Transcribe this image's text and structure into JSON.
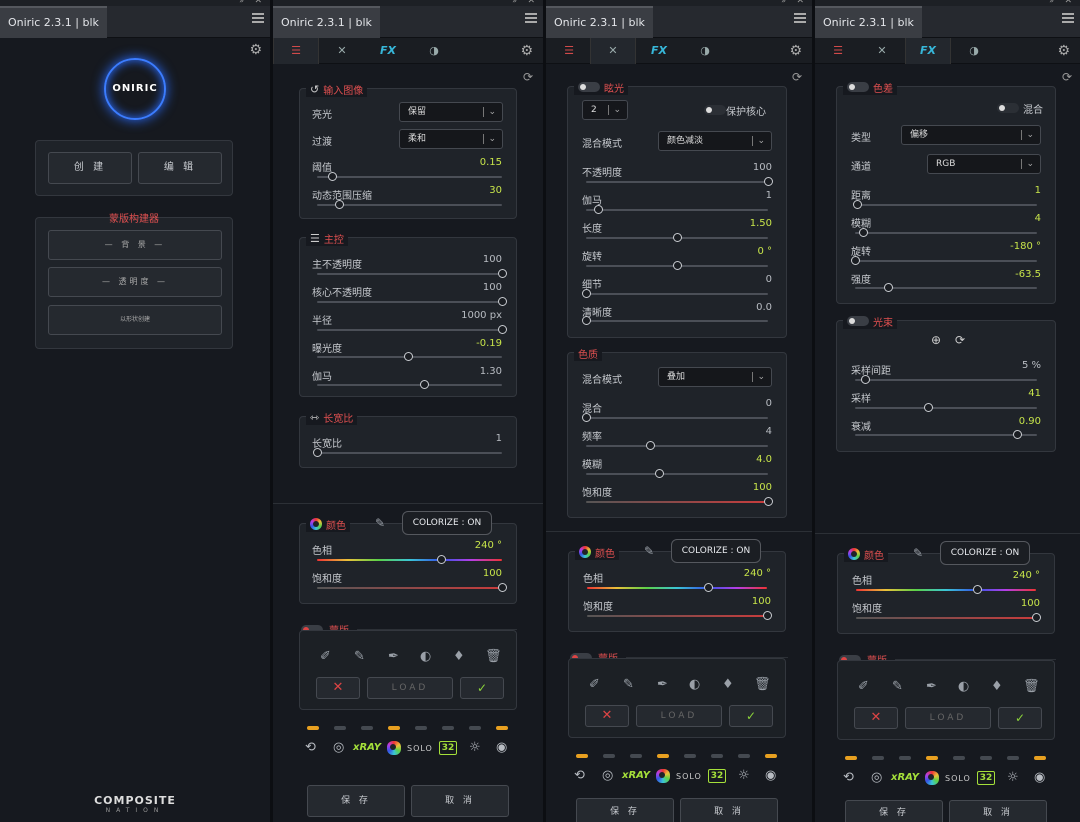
{
  "app_title": "Oniric 2.3.1 | blk",
  "brand": {
    "logo_text": "ONIRIC",
    "footer_main": "COMPOSITE",
    "footer_sub": "NATION"
  },
  "panel1": {
    "btn_create": "创 建",
    "btn_edit": "编 辑",
    "section_title": "蒙版构建器",
    "btn_layer": "— 背 景 —",
    "btn_transparency": "— 透明度 —",
    "btn_small": "以形状创建"
  },
  "input": {
    "title": "输入图像",
    "row1_label": "亮光",
    "row1_value": "保留",
    "row2_label": "过渡",
    "row2_value": "柔和",
    "threshold_label": "阈值",
    "threshold_value": "0.15",
    "dr_label": "动态范围压缩",
    "dr_value": "30"
  },
  "main": {
    "title": "主控",
    "opacity_label": "主不透明度",
    "opacity_value": "100",
    "core_label": "核心不透明度",
    "core_value": "100",
    "radius_label": "半径",
    "radius_value": "1000 px",
    "exposure_label": "曝光度",
    "exposure_value": "-0.19",
    "gamma_label": "伽马",
    "gamma_value": "1.30"
  },
  "aspect": {
    "title": "长宽比",
    "label": "长宽比",
    "value": "1"
  },
  "color": {
    "title": "颜色",
    "colorize": "COLORIZE : ON",
    "hue_label": "色相",
    "hue_value": "240 °",
    "sat_label": "饱和度",
    "sat_value": "100"
  },
  "mask": {
    "title": "蒙版",
    "load": "LOAD"
  },
  "bottom": {
    "xray": "xRAY",
    "solo": "SOLO",
    "count": "32",
    "save": "保 存",
    "cancel": "取 消"
  },
  "glow": {
    "title": "眩光",
    "count": "2",
    "protect": "保护核心",
    "blend_label": "混合模式",
    "blend_value": "颜色减淡",
    "opacity_label": "不透明度",
    "opacity_value": "100",
    "gamma_label": "伽马",
    "gamma_value": "1",
    "length_label": "长度",
    "length_value": "1.50",
    "rotate_label": "旋转",
    "rotate_value": "0 °",
    "detail_label": "细节",
    "detail_value": "0",
    "sharp_label": "清晰度",
    "sharp_value": "0.0"
  },
  "texture": {
    "title": "色质",
    "blend_label": "混合模式",
    "blend_value": "叠加",
    "mix_label": "混合",
    "mix_value": "0",
    "freq_label": "频率",
    "freq_value": "4",
    "blur_label": "模糊",
    "blur_value": "4.0",
    "sat_label": "饱和度",
    "sat_value": "100"
  },
  "chroma": {
    "title": "色差",
    "mix": "混合",
    "type_label": "类型",
    "type_value": "偏移",
    "channel_label": "通道",
    "channel_value": "RGB",
    "dist_label": "距离",
    "dist_value": "1",
    "blur_label": "模糊",
    "blur_value": "4",
    "rotate_label": "旋转",
    "rotate_value": "-180 °",
    "strength_label": "强度",
    "strength_value": "-63.5"
  },
  "rays": {
    "title": "光束",
    "step_label": "采样间距",
    "step_value": "5 %",
    "samples_label": "采样",
    "samples_value": "41",
    "decay_label": "衰减",
    "decay_value": "0.90"
  },
  "colors": {
    "accent_red": "#e05050",
    "accent_green": "#c7e44a",
    "indicator": "#e8a020"
  }
}
